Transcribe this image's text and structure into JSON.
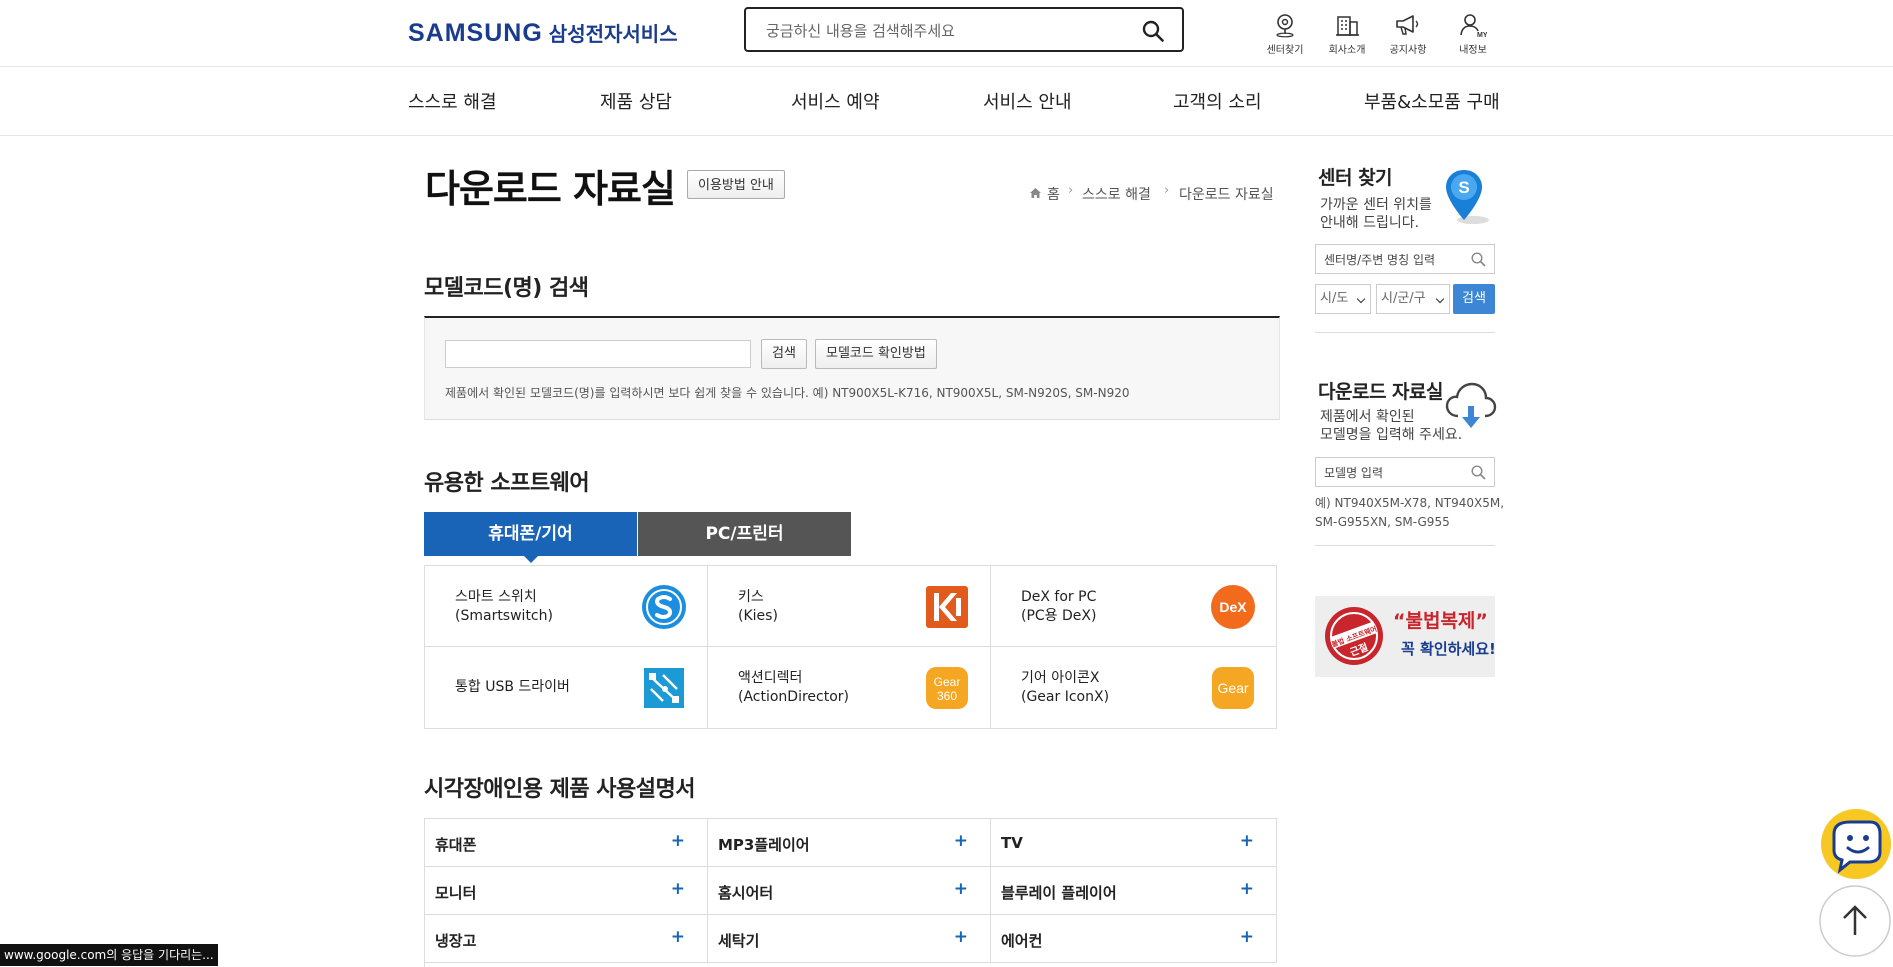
{
  "header": {
    "logo_en": "SAMSUNG",
    "logo_ko": "삼성전자서비스",
    "search_placeholder": "궁금하신 내용을 검색해주세요",
    "icons": [
      {
        "label": "센터찾기",
        "icon": "location-pin-icon"
      },
      {
        "label": "회사소개",
        "icon": "building-icon"
      },
      {
        "label": "공지사항",
        "icon": "megaphone-icon"
      },
      {
        "label": "내정보",
        "icon": "user-icon"
      }
    ]
  },
  "nav": [
    "스스로 해결",
    "제품 상담",
    "서비스 예약",
    "서비스 안내",
    "고객의 소리",
    "부품&소모품 구매"
  ],
  "page": {
    "title": "다운로드 자료실",
    "guide_button": "이용방법 안내",
    "breadcrumb": [
      "홈",
      "스스로 해결",
      "다운로드 자료실"
    ]
  },
  "model_search": {
    "heading": "모델코드(명) 검색",
    "search_button": "검색",
    "howto_button": "모델코드 확인방법",
    "description": "제품에서 확인된 모델코드(명)를 입력하시면 보다 쉽게 찾을 수 있습니다. 예) NT900X5L-K716, NT900X5L, SM-N920S, SM-N920"
  },
  "software": {
    "heading": "유용한 소프트웨어",
    "tabs": [
      "휴대폰/기어",
      "PC/프린터"
    ],
    "active_tab": 0,
    "items": [
      {
        "name1": "스마트 스위치",
        "name2": "(Smartswitch)",
        "icon": "smartswitch-icon",
        "color": "#1b8ee0"
      },
      {
        "name1": "키스",
        "name2": "(Kies)",
        "icon": "kies-icon",
        "color": "#e25a1c"
      },
      {
        "name1": "DeX for PC",
        "name2": "(PC용 DeX)",
        "icon": "dex-icon",
        "color": "#f26b1d"
      },
      {
        "name1": "통합 USB 드라이버",
        "name2": "",
        "icon": "usb-driver-icon",
        "color": "#1b9ad6"
      },
      {
        "name1": "액션디렉터",
        "name2": "(ActionDirector)",
        "icon": "gear360-icon",
        "color": "#f5a623"
      },
      {
        "name1": "기어 아이콘X",
        "name2": "(Gear IconX)",
        "icon": "gear-iconx-icon",
        "color": "#f5a623"
      }
    ],
    "icon_text": {
      "dex": "DeX",
      "gear360_a": "Gear",
      "gear360_b": "360",
      "gear": "Gear"
    }
  },
  "manuals": {
    "heading": "시각장애인용 제품 사용설명서",
    "items": [
      "휴대폰",
      "MP3플레이어",
      "TV",
      "모니터",
      "홈시어터",
      "블루레이 플레이어",
      "냉장고",
      "세탁기",
      "에어컨"
    ]
  },
  "sidebar": {
    "center": {
      "title": "센터 찾기",
      "desc1": "가까운 센터 위치를",
      "desc2": "안내해 드립니다.",
      "input_placeholder": "센터명/주변 명칭 입력",
      "select1": "시/도",
      "select2": "시/군/구",
      "button": "검색"
    },
    "download": {
      "title": "다운로드 자료실",
      "desc1": "제품에서 확인된",
      "desc2": "모델명을 입력해 주세요.",
      "input_placeholder": "모델명 입력",
      "example1": "예) NT940X5M-X78, NT940X5M,",
      "example2": "SM-G955XN, SM-G955"
    },
    "banner": {
      "stamp1": "불법 소프트웨어",
      "stamp2": "근절",
      "title": "“불법복제”",
      "sub": "꼭 확인하세요!"
    }
  },
  "status_bar": "www.google.com의 응답을 기다리는...",
  "colors": {
    "brand": "#1a3c8f",
    "accent": "#1a64b8",
    "button_blue": "#3d86d6"
  }
}
